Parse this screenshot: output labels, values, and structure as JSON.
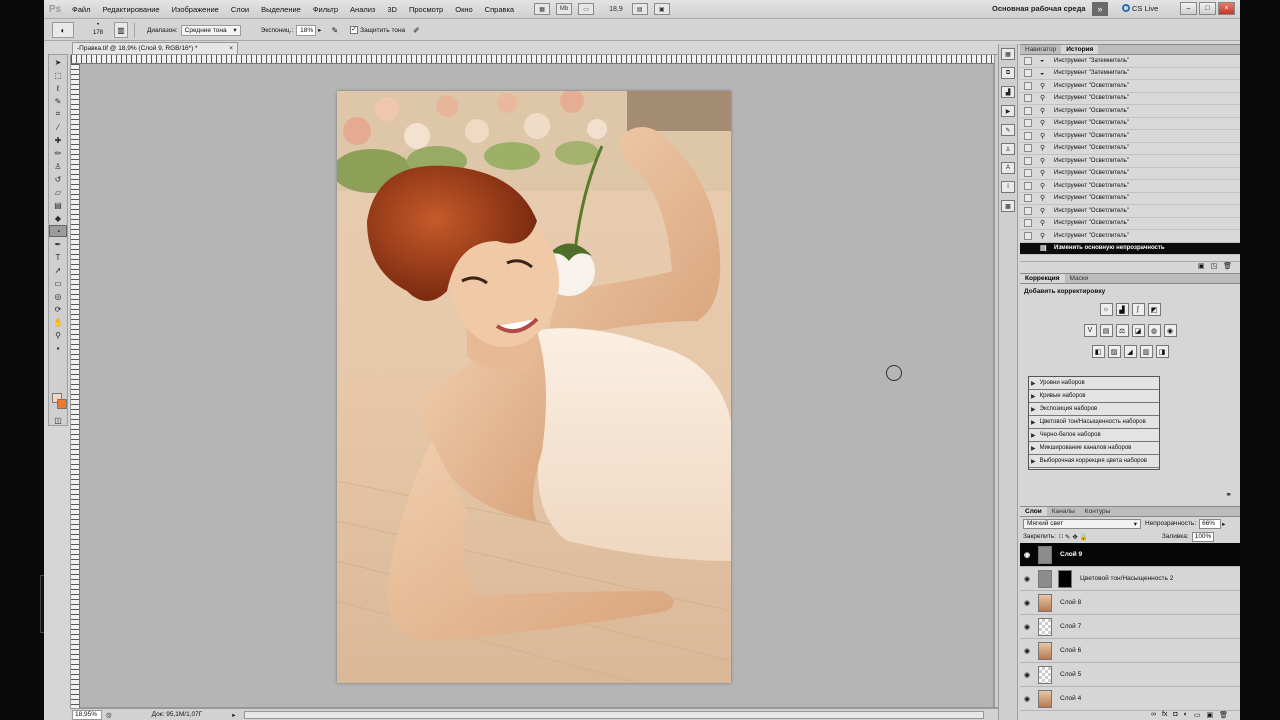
{
  "menubar": {
    "logo": "Ps",
    "items": [
      "Файл",
      "Редактирование",
      "Изображение",
      "Слои",
      "Выделение",
      "Фильтр",
      "Анализ",
      "3D",
      "Просмотр",
      "Окно",
      "Справка"
    ],
    "zoom_value": "18,9",
    "mb_label": "Mb",
    "workspace": "Основная рабочая среда",
    "workspace_more": "»",
    "cs_live": "CS Live"
  },
  "options": {
    "brush_size": "178",
    "range_label": "Диапазон:",
    "range_value": "Средние тона",
    "exposure_label": "Экспониц.:",
    "exposure_value": "18%",
    "protect_label": "Защитить тона"
  },
  "document": {
    "tab_title": "-Правка.tif @ 18,9% (Слой 9, RGB/16*) *",
    "tab_close": "×",
    "status_zoom": "18,95%",
    "status_doc": "Док: 95,1M/1,07Г"
  },
  "history": {
    "tabs": [
      "Навигатор",
      "История"
    ],
    "items": [
      {
        "icon": "burn-tool-icon",
        "label": "Инструмент \"Затемнитель\""
      },
      {
        "icon": "burn-tool-icon",
        "label": "Инструмент \"Затемнитель\""
      },
      {
        "icon": "dodge-tool-icon",
        "label": "Инструмент \"Осветлитель\""
      },
      {
        "icon": "dodge-tool-icon",
        "label": "Инструмент \"Осветлитель\""
      },
      {
        "icon": "dodge-tool-icon",
        "label": "Инструмент \"Осветлитель\""
      },
      {
        "icon": "dodge-tool-icon",
        "label": "Инструмент \"Осветлитель\""
      },
      {
        "icon": "dodge-tool-icon",
        "label": "Инструмент \"Осветлитель\""
      },
      {
        "icon": "dodge-tool-icon",
        "label": "Инструмент \"Осветлитель\""
      },
      {
        "icon": "dodge-tool-icon",
        "label": "Инструмент \"Осветлитель\""
      },
      {
        "icon": "dodge-tool-icon",
        "label": "Инструмент \"Осветлитель\""
      },
      {
        "icon": "dodge-tool-icon",
        "label": "Инструмент \"Осветлитель\""
      },
      {
        "icon": "dodge-tool-icon",
        "label": "Инструмент \"Осветлитель\""
      },
      {
        "icon": "dodge-tool-icon",
        "label": "Инструмент \"Осветлитель\""
      },
      {
        "icon": "dodge-tool-icon",
        "label": "Инструмент \"Осветлитель\""
      },
      {
        "icon": "dodge-tool-icon",
        "label": "Инструмент \"Осветлитель\""
      },
      {
        "icon": "opacity-icon",
        "label": "Изменить основную непрозрачность",
        "selected": true
      }
    ]
  },
  "adjustments": {
    "tabs": [
      "Коррекция",
      "Маски"
    ],
    "title": "Добавить корректировку",
    "presets": [
      "Уровни наборов",
      "Кривые наборов",
      "Экспозиция наборов",
      "Цветовой тон/Насыщенность наборов",
      "Черно-белое наборов",
      "Микширование каналов наборов",
      "Выборочная коррекция цвета наборов"
    ]
  },
  "layers": {
    "tabs": [
      "Слои",
      "Каналы",
      "Контуры"
    ],
    "blend_mode": "Мягкий свет",
    "opacity_label": "Непрозрачность:",
    "opacity_value": "66%",
    "lock_label": "Закрепить:",
    "fill_label": "Заливка:",
    "fill_value": "100%",
    "items": [
      {
        "name": "Слой 9",
        "thumb": "grey",
        "selected": true
      },
      {
        "name": "Цветовой тон/Насыщенность 2",
        "thumb": "adjust"
      },
      {
        "name": "Слой 8",
        "thumb": "photo"
      },
      {
        "name": "Слой 7",
        "thumb": "transp"
      },
      {
        "name": "Слой 6",
        "thumb": "photo"
      },
      {
        "name": "Слой 5",
        "thumb": "transp"
      },
      {
        "name": "Слой 4",
        "thumb": "photo"
      }
    ]
  },
  "colors": {
    "foreground": "#f3d7c4",
    "background": "#e87a32",
    "selection": "#060606"
  }
}
